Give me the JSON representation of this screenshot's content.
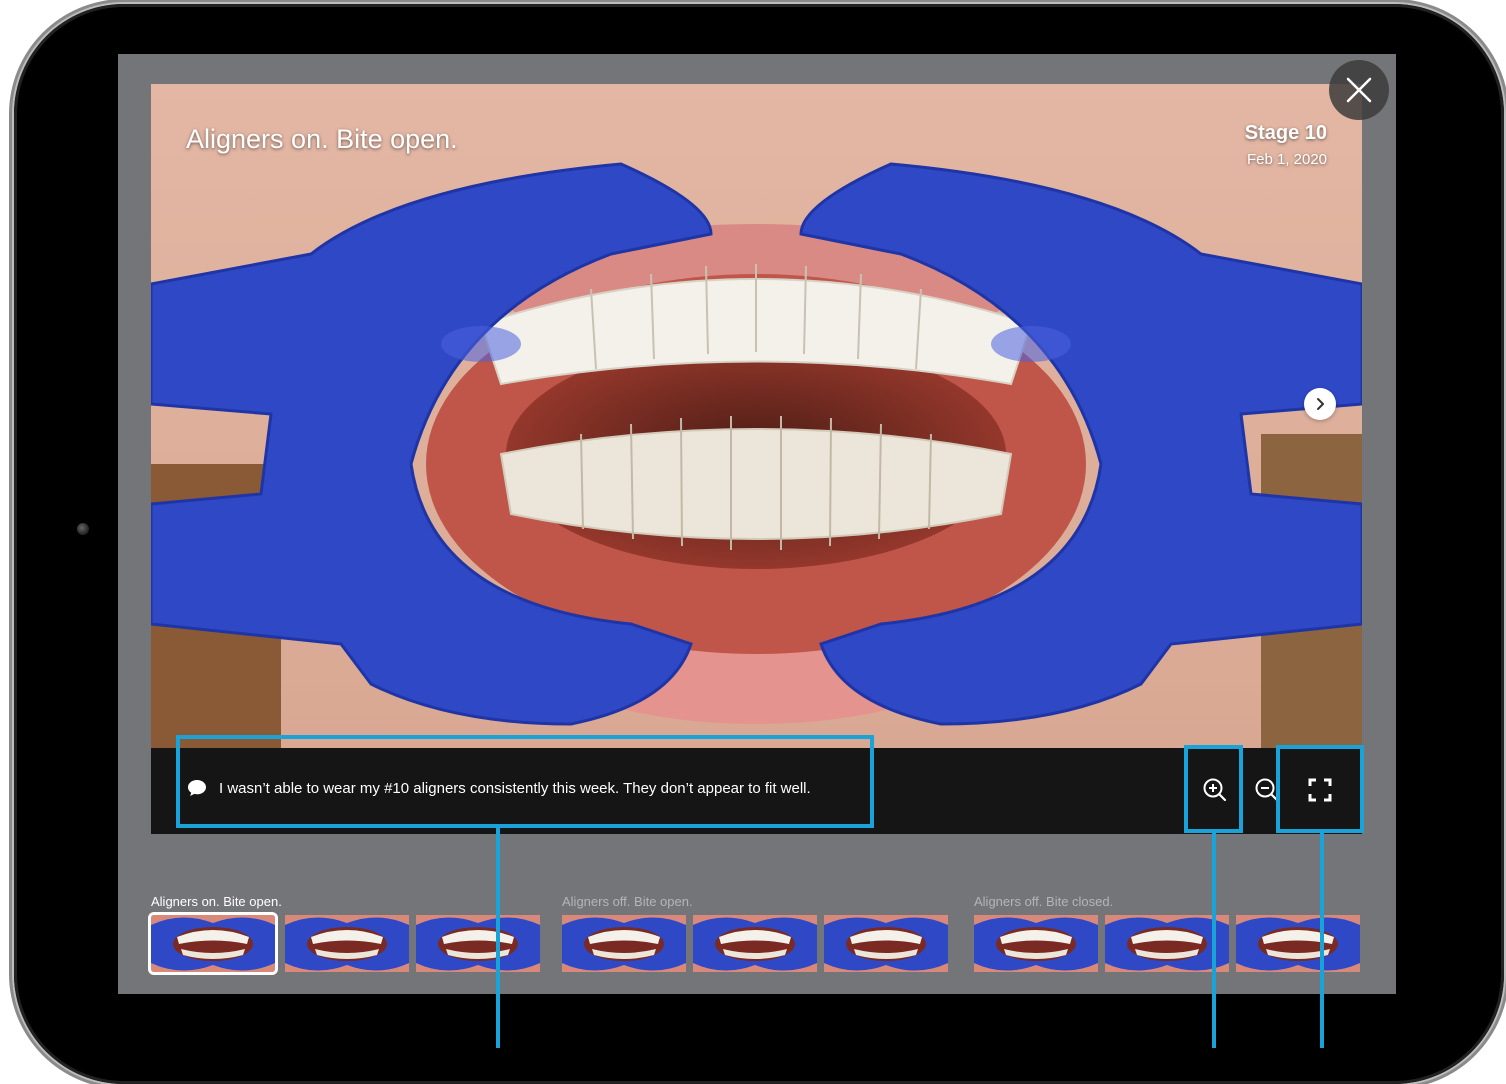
{
  "viewer": {
    "photo_title": "Aligners on. Bite open.",
    "stage_title": "Stage 10",
    "stage_date": "Feb 1, 2020",
    "comment": "I wasn’t able to wear my #10 aligners consistently this week. They don’t appear to fit well."
  },
  "icons": {
    "close": "close-icon",
    "next": "chevron-right-icon",
    "comment": "chat-bubble-icon",
    "zoom_in": "zoom-in-icon",
    "zoom_out": "zoom-out-icon",
    "fullscreen": "fullscreen-icon"
  },
  "thumbnail_groups": [
    {
      "label": "Aligners on. Bite open.",
      "active": true,
      "count": 3,
      "selected_index": 0
    },
    {
      "label": "Aligners off. Bite open.",
      "active": false,
      "count": 3
    },
    {
      "label": "Aligners off. Bite closed.",
      "active": false,
      "count": 3
    }
  ],
  "colors": {
    "retractor_blue": "#2f48c6",
    "annotation_blue": "#1aa3d9",
    "screen_gray": "#747578",
    "caption_bar": "#151515"
  }
}
